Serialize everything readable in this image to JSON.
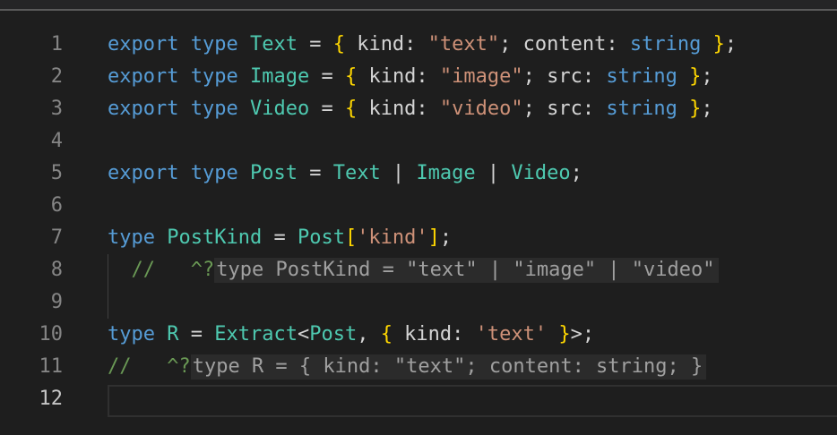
{
  "lines": [
    {
      "n": "1",
      "tokens": [
        {
          "t": "export",
          "c": "kw"
        },
        {
          "t": " "
        },
        {
          "t": "type",
          "c": "kw"
        },
        {
          "t": " "
        },
        {
          "t": "Text",
          "c": "ty"
        },
        {
          "t": " = "
        },
        {
          "t": "{",
          "c": "br"
        },
        {
          "t": " kind: "
        },
        {
          "t": "\"text\"",
          "c": "str"
        },
        {
          "t": "; content: "
        },
        {
          "t": "string",
          "c": "kw"
        },
        {
          "t": " "
        },
        {
          "t": "}",
          "c": "br"
        },
        {
          "t": ";"
        }
      ]
    },
    {
      "n": "2",
      "tokens": [
        {
          "t": "export",
          "c": "kw"
        },
        {
          "t": " "
        },
        {
          "t": "type",
          "c": "kw"
        },
        {
          "t": " "
        },
        {
          "t": "Image",
          "c": "ty"
        },
        {
          "t": " = "
        },
        {
          "t": "{",
          "c": "br"
        },
        {
          "t": " kind: "
        },
        {
          "t": "\"image\"",
          "c": "str"
        },
        {
          "t": "; src: "
        },
        {
          "t": "string",
          "c": "kw"
        },
        {
          "t": " "
        },
        {
          "t": "}",
          "c": "br"
        },
        {
          "t": ";"
        }
      ]
    },
    {
      "n": "3",
      "tokens": [
        {
          "t": "export",
          "c": "kw"
        },
        {
          "t": " "
        },
        {
          "t": "type",
          "c": "kw"
        },
        {
          "t": " "
        },
        {
          "t": "Video",
          "c": "ty"
        },
        {
          "t": " = "
        },
        {
          "t": "{",
          "c": "br"
        },
        {
          "t": " kind: "
        },
        {
          "t": "\"video\"",
          "c": "str"
        },
        {
          "t": "; src: "
        },
        {
          "t": "string",
          "c": "kw"
        },
        {
          "t": " "
        },
        {
          "t": "}",
          "c": "br"
        },
        {
          "t": ";"
        }
      ]
    },
    {
      "n": "4",
      "tokens": []
    },
    {
      "n": "5",
      "tokens": [
        {
          "t": "export",
          "c": "kw"
        },
        {
          "t": " "
        },
        {
          "t": "type",
          "c": "kw"
        },
        {
          "t": " "
        },
        {
          "t": "Post",
          "c": "ty"
        },
        {
          "t": " = "
        },
        {
          "t": "Text",
          "c": "ty"
        },
        {
          "t": " | "
        },
        {
          "t": "Image",
          "c": "ty"
        },
        {
          "t": " | "
        },
        {
          "t": "Video",
          "c": "ty"
        },
        {
          "t": ";"
        }
      ]
    },
    {
      "n": "6",
      "tokens": []
    },
    {
      "n": "7",
      "tokens": [
        {
          "t": "type",
          "c": "kw"
        },
        {
          "t": " "
        },
        {
          "t": "PostKind",
          "c": "ty"
        },
        {
          "t": " = "
        },
        {
          "t": "Post",
          "c": "ty"
        },
        {
          "t": "[",
          "c": "br"
        },
        {
          "t": "'kind'",
          "c": "str"
        },
        {
          "t": "]",
          "c": "br"
        },
        {
          "t": ";"
        }
      ]
    },
    {
      "n": "8",
      "tokens": [
        {
          "t": "  //   ^?",
          "c": "cm"
        },
        {
          "t": "type PostKind = \"text\" | \"image\" | \"video\"",
          "c": "hint"
        }
      ]
    },
    {
      "n": "9",
      "tokens": []
    },
    {
      "n": "10",
      "tokens": [
        {
          "t": "type",
          "c": "kw"
        },
        {
          "t": " "
        },
        {
          "t": "R",
          "c": "ty"
        },
        {
          "t": " = "
        },
        {
          "t": "Extract",
          "c": "ty"
        },
        {
          "t": "<"
        },
        {
          "t": "Post",
          "c": "ty"
        },
        {
          "t": ", "
        },
        {
          "t": "{",
          "c": "br"
        },
        {
          "t": " kind: "
        },
        {
          "t": "'text'",
          "c": "str"
        },
        {
          "t": " "
        },
        {
          "t": "}",
          "c": "br"
        },
        {
          "t": ">;"
        }
      ]
    },
    {
      "n": "11",
      "tokens": [
        {
          "t": "//   ^?",
          "c": "cm"
        },
        {
          "t": "type R = { kind: \"text\"; content: string; }",
          "c": "hint"
        }
      ]
    },
    {
      "n": "12",
      "tokens": [],
      "active": true
    }
  ]
}
